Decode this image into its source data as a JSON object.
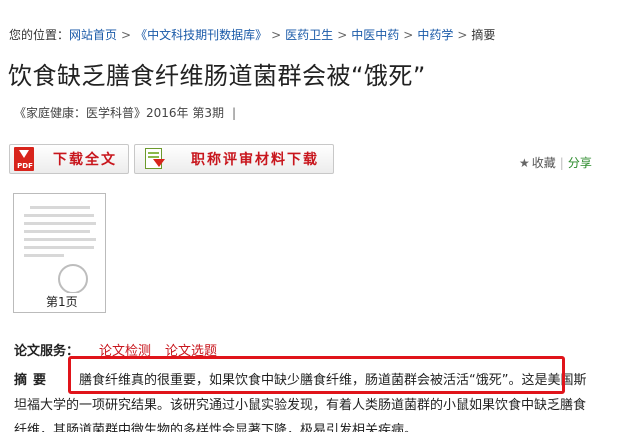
{
  "breadcrumb": {
    "prefix": "您的位置：",
    "items": [
      "网站首页",
      "《中文科技期刊数据库》",
      "医药卫生",
      "中医中药",
      "中药学",
      "摘要"
    ],
    "separator": ">"
  },
  "article": {
    "title": "饮食缺乏膳食纤维肠道菌群会被“饿死”",
    "source": "《家庭健康：医学科普》2016年 第3期",
    "source_bar": "|"
  },
  "actions": {
    "pdf_badge": "PDF",
    "download_label": "下载全文",
    "title_material_label": "职称评审材料下载",
    "favorite_label": "收藏",
    "share_label": "分享",
    "separator": "|"
  },
  "preview": {
    "page_label": "第1页"
  },
  "services": {
    "label": "论文服务：",
    "links": [
      "论文检测",
      "论文选题"
    ]
  },
  "abstract": {
    "label": "摘要",
    "line1": "：膳食纤维真的很重要，如果饮食中缺少膳食纤维，肠道菌群会被活活“饿死”。这是美国斯",
    "line2": "坦福大学的一项研究结果。该研究通过小鼠实验发现，有着人类肠道菌群的小鼠如果饮食中缺乏膳食",
    "line3": "纤维，其肠道菌群中微生物的多样性会显著下降，极易引发相关疾病。"
  },
  "colors": {
    "link": "#1a5aa8",
    "accent_red": "#c8161d",
    "share_green": "#2a8a2a",
    "highlight_border": "#e0141a"
  }
}
